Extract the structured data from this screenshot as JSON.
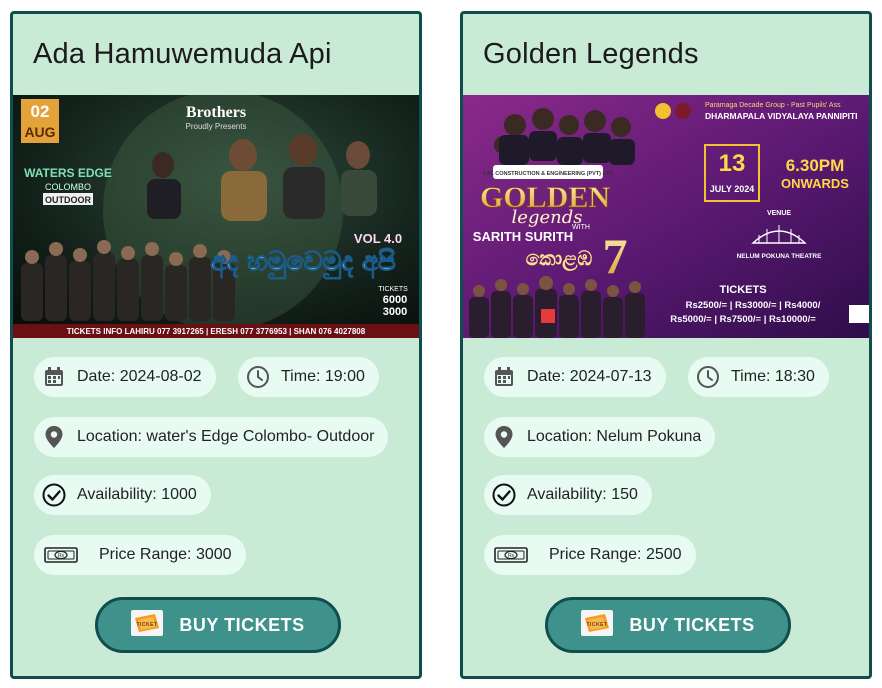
{
  "events": [
    {
      "title": "Ada Hamuwemuda Api",
      "date": "Date: 2024-08-02",
      "time": "Time: 19:00",
      "location": "Location: water's Edge Colombo- Outdoor",
      "availability": "Availability: 1000",
      "price": "Price Range: 3000",
      "buy_label": "BUY TICKETS",
      "poster": {
        "day": "02",
        "month": "AUG",
        "venue_1": "WATERS EDGE",
        "venue_2": "COLOMBO",
        "venue_3": "OUTDOOR",
        "presenter": "Brothers",
        "presenter_sub": "Proudly Presents",
        "vol": "VOL 4.0",
        "sinhala_title": "අද හමුවෙමුද අපි",
        "ticket_word": "TICKETS",
        "ticket_prices": [
          "6000",
          "3000"
        ],
        "contact_line": "TICKETS INFO   LAHIRU 077 3917265  |  ERESH 077 3776953  |  SHAN 076 4027808"
      }
    },
    {
      "title": "Golden Legends",
      "date": "Date: 2024-07-13",
      "time": "Time: 18:30",
      "location": "Location: Nelum Pokuna",
      "availability": "Availability: 150",
      "price": "Price Range: 2500",
      "buy_label": "BUY TICKETS",
      "poster": {
        "org_line": "Paramaga Decade Group - Past Pupils' Ass",
        "school": "DHARMAPALA VIDYALAYA PANNIPITI",
        "sponsor": "LAL CONSTRUCTION & ENGINEERING (PVT) LTD",
        "headline_1": "GOLDEN",
        "headline_2": "legends",
        "with": "WITH",
        "artist": "SARITH SURITH",
        "sinhala": "කොළඹ",
        "number": "7",
        "day": "13",
        "month_year": "JULY 2024",
        "time_1": "6.30PM",
        "time_2": "ONWARDS",
        "venue_word": "VENUE",
        "venue_name": "NELUM POKUNA THEATRE",
        "tickets_word": "TICKETS",
        "prices_1": "Rs2500/= | Rs3000/= | Rs4000/",
        "prices_2": "Rs5000/= | Rs7500/= | Rs10000/="
      }
    }
  ],
  "icons": {
    "date": "calendar-icon",
    "time": "clock-icon",
    "location": "map-pin-icon",
    "availability": "check-circle-icon",
    "price": "banknote-icon",
    "buy": "ticket-icon"
  },
  "colors": {
    "card_bg": "#c9ead4",
    "card_border": "#0f4d4f",
    "pill_bg": "#e8fbf3",
    "button_bg": "#3f918c"
  }
}
